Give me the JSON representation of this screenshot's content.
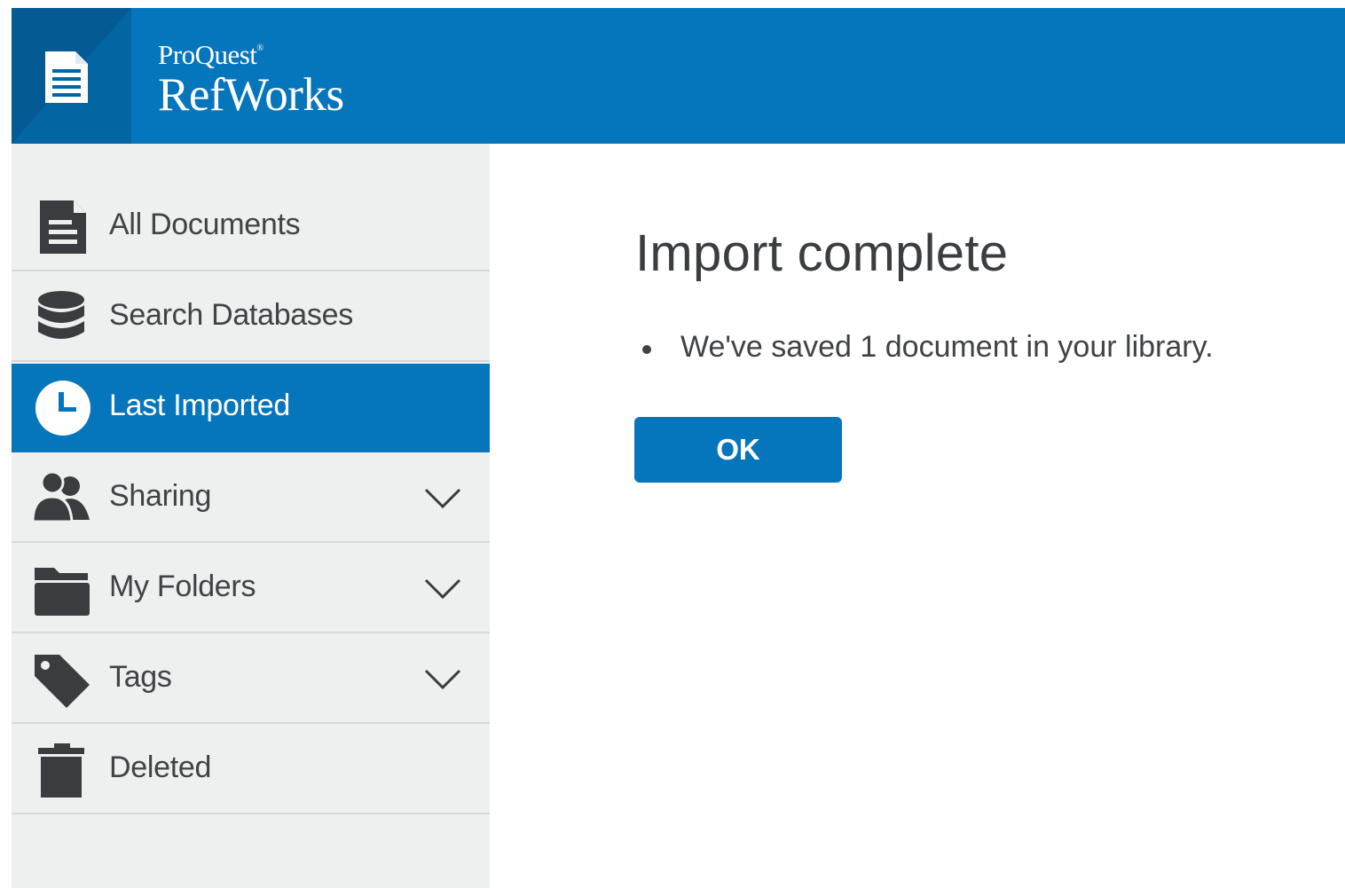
{
  "header": {
    "brand_top": "ProQuest",
    "brand_mark": "®",
    "brand_main": "RefWorks",
    "icon": "document-icon"
  },
  "sidebar": {
    "items": [
      {
        "label": "All Documents",
        "icon": "document-icon",
        "active": false,
        "expandable": false
      },
      {
        "label": "Search Databases",
        "icon": "database-icon",
        "active": false,
        "expandable": false
      },
      {
        "label": "Last Imported",
        "icon": "clock-icon",
        "active": true,
        "expandable": false
      },
      {
        "label": "Sharing",
        "icon": "users-icon",
        "active": false,
        "expandable": true
      },
      {
        "label": "My Folders",
        "icon": "folder-icon",
        "active": false,
        "expandable": true
      },
      {
        "label": "Tags",
        "icon": "tag-icon",
        "active": false,
        "expandable": true
      },
      {
        "label": "Deleted",
        "icon": "trash-icon",
        "active": false,
        "expandable": false
      }
    ]
  },
  "main": {
    "title": "Import complete",
    "messages": [
      "We've saved 1 document in your library."
    ],
    "ok_label": "OK"
  },
  "colors": {
    "brand_blue": "#0676bc",
    "sidebar_bg": "#eeefef",
    "icon_dark": "#3a3d40"
  }
}
